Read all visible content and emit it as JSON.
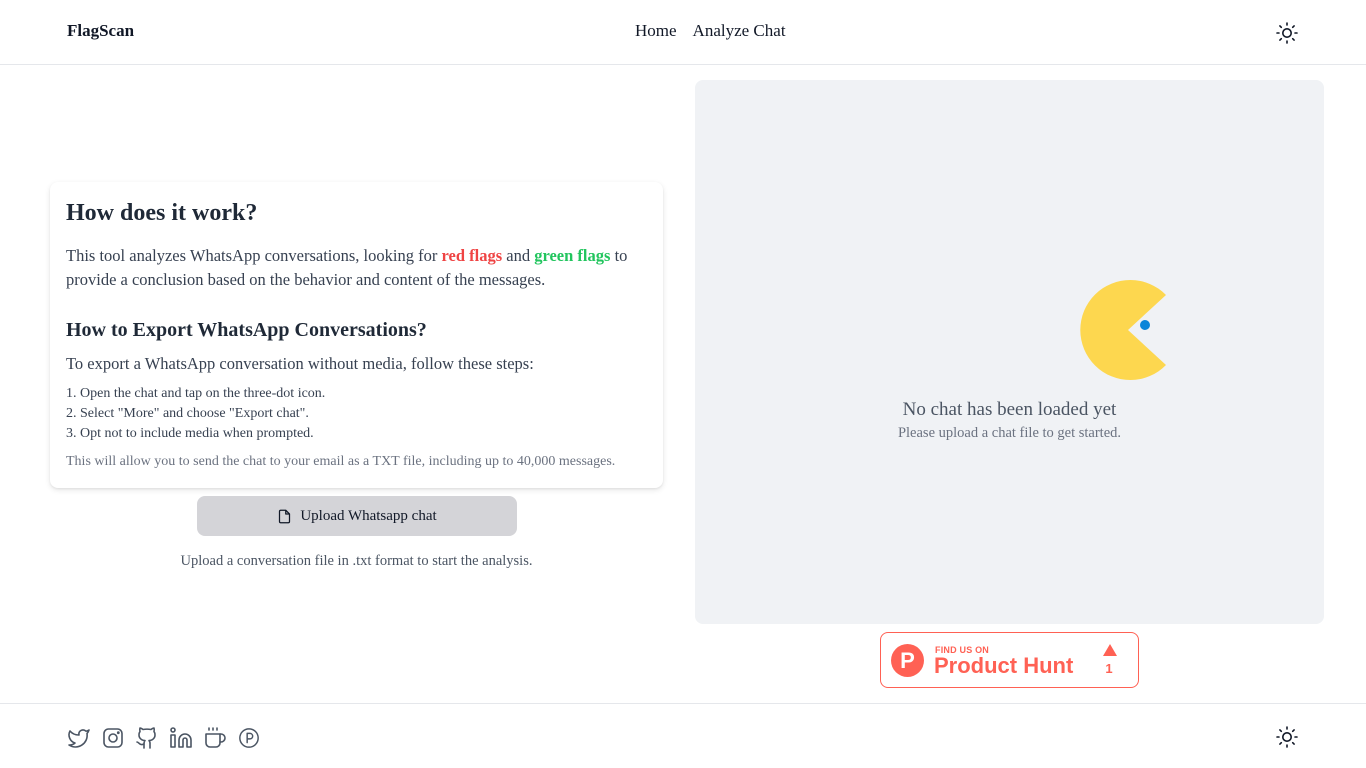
{
  "header": {
    "brand": "FlagScan",
    "nav": [
      {
        "label": "Home"
      },
      {
        "label": "Analyze Chat"
      }
    ]
  },
  "info": {
    "title": "How does it work?",
    "intro_before": "This tool analyzes WhatsApp conversations, looking for ",
    "red_flags": "red flags",
    "intro_and": " and ",
    "green_flags": "green flags",
    "intro_after": " to provide a conclusion based on the behavior and content of the messages.",
    "export_title": "How to Export WhatsApp Conversations?",
    "steps_intro": "To export a WhatsApp conversation without media, follow these steps:",
    "steps": [
      "1. Open the chat and tap on the three-dot icon.",
      "2. Select \"More\" and choose \"Export chat\".",
      "3. Opt not to include media when prompted."
    ],
    "note": "This will allow you to send the chat to your email as a TXT file, including up to 40,000 messages."
  },
  "upload": {
    "button_label": "Upload Whatsapp chat",
    "hint": "Upload a conversation file in .txt format to start the analysis."
  },
  "chat_panel": {
    "empty_title": "No chat has been loaded yet",
    "empty_subtitle": "Please upload a chat file to get started."
  },
  "product_hunt": {
    "small": "FIND US ON",
    "big": "Product Hunt",
    "count": "1"
  },
  "colors": {
    "red_flag": "#ef4444",
    "green_flag": "#22c55e",
    "pacman": "#fdd74f",
    "pacman_eye": "#0a85d9",
    "product_hunt": "#ff6154",
    "panel_bg": "#f0f2f5"
  },
  "footer": {
    "icons": [
      "twitter-icon",
      "instagram-icon",
      "github-icon",
      "linkedin-icon",
      "coffee-icon",
      "product-hunt-icon"
    ]
  }
}
